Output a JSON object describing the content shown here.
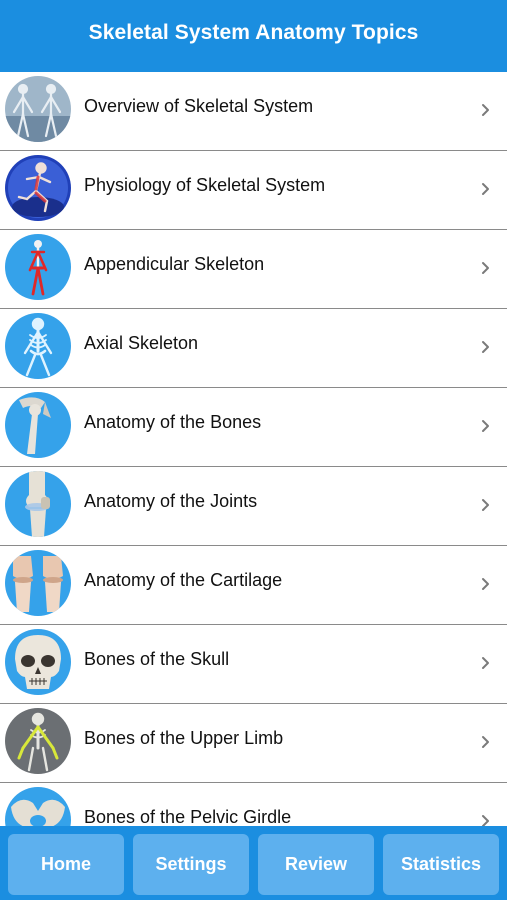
{
  "header": {
    "title": "Skeletal System Anatomy Topics"
  },
  "topics": [
    {
      "label": "Overview of Skeletal System",
      "icon": "skeleton-overview-icon"
    },
    {
      "label": "Physiology of Skeletal System",
      "icon": "running-skeleton-icon"
    },
    {
      "label": "Appendicular Skeleton",
      "icon": "appendicular-skeleton-icon"
    },
    {
      "label": "Axial Skeleton",
      "icon": "axial-skeleton-icon"
    },
    {
      "label": "Anatomy of the Bones",
      "icon": "shoulder-bone-icon"
    },
    {
      "label": "Anatomy of the Joints",
      "icon": "knee-joint-icon"
    },
    {
      "label": "Anatomy of the Cartilage",
      "icon": "cartilage-icon"
    },
    {
      "label": "Bones of the Skull",
      "icon": "skull-icon"
    },
    {
      "label": "Bones of the Upper Limb",
      "icon": "upper-limb-icon"
    },
    {
      "label": "Bones of the Pelvic Girdle",
      "icon": "pelvis-icon"
    }
  ],
  "tabs": [
    {
      "label": "Home"
    },
    {
      "label": "Settings"
    },
    {
      "label": "Review"
    },
    {
      "label": "Statistics"
    }
  ],
  "colors": {
    "primary": "#1b8ee0",
    "tab_button": "#5db0ee",
    "thumb_bg": "#35a2ea"
  }
}
